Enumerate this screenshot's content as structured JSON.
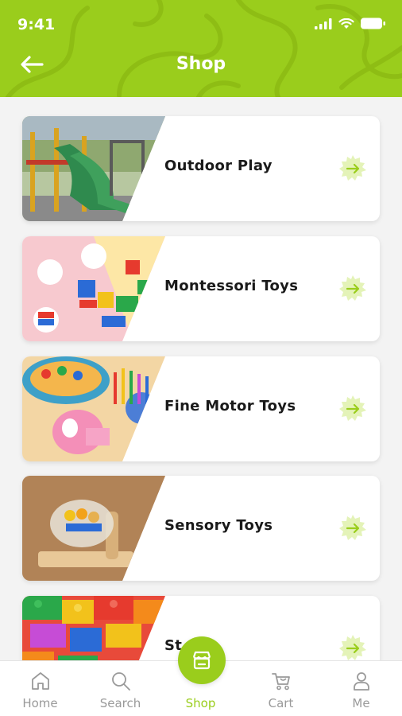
{
  "status_bar": {
    "time": "9:41"
  },
  "header": {
    "title": "Shop"
  },
  "categories": [
    {
      "label": "Outdoor Play"
    },
    {
      "label": "Montessori Toys"
    },
    {
      "label": "Fine Motor Toys"
    },
    {
      "label": "Sensory Toys"
    },
    {
      "label": "St"
    }
  ],
  "bottom_nav": {
    "items": [
      {
        "label": "Home"
      },
      {
        "label": "Search"
      },
      {
        "label": "Shop"
      },
      {
        "label": "Cart"
      },
      {
        "label": "Me"
      }
    ],
    "active": "Shop"
  },
  "colors": {
    "accent": "#9acd1c",
    "accent_light": "#e4f3b8",
    "inactive": "#9a9a9a"
  }
}
